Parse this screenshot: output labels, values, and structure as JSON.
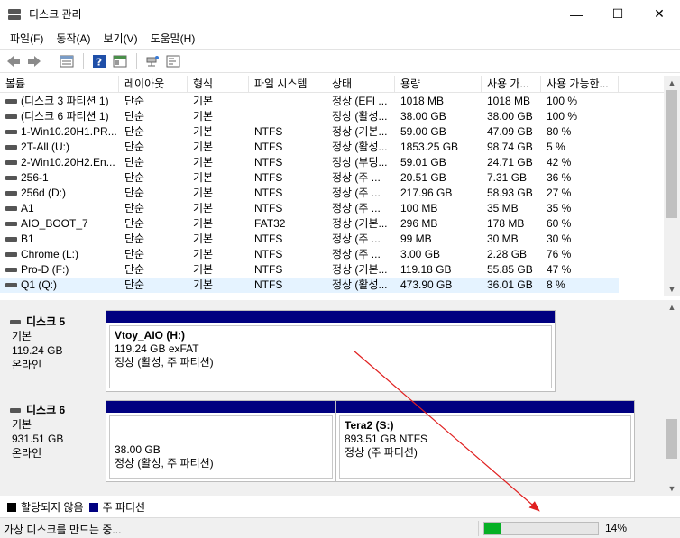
{
  "window": {
    "title": "디스크 관리",
    "min_glyph": "—",
    "max_glyph": "☐",
    "close_glyph": "✕"
  },
  "menu": [
    "파일(F)",
    "동작(A)",
    "보기(V)",
    "도움말(H)"
  ],
  "columns": [
    "볼륨",
    "레이아웃",
    "형식",
    "파일 시스템",
    "상태",
    "용량",
    "사용 가...",
    "사용 가능한..."
  ],
  "volumes": [
    [
      "(디스크 3 파티션 1)",
      "단순",
      "기본",
      "",
      "정상 (EFI ...",
      "1018 MB",
      "1018 MB",
      "100 %"
    ],
    [
      "(디스크 6 파티션 1)",
      "단순",
      "기본",
      "",
      "정상 (활성...",
      "38.00 GB",
      "38.00 GB",
      "100 %"
    ],
    [
      "1-Win10.20H1.PR...",
      "단순",
      "기본",
      "NTFS",
      "정상 (기본...",
      "59.00 GB",
      "47.09 GB",
      "80 %"
    ],
    [
      "2T-All (U:)",
      "단순",
      "기본",
      "NTFS",
      "정상 (활성...",
      "1853.25 GB",
      "98.74 GB",
      "5 %"
    ],
    [
      "2-Win10.20H2.En...",
      "단순",
      "기본",
      "NTFS",
      "정상 (부팅...",
      "59.01 GB",
      "24.71 GB",
      "42 %"
    ],
    [
      "256-1",
      "단순",
      "기본",
      "NTFS",
      "정상 (주 ...",
      "20.51 GB",
      "7.31 GB",
      "36 %"
    ],
    [
      "256d (D:)",
      "단순",
      "기본",
      "NTFS",
      "정상 (주 ...",
      "217.96 GB",
      "58.93 GB",
      "27 %"
    ],
    [
      "A1",
      "단순",
      "기본",
      "NTFS",
      "정상 (주 ...",
      "100 MB",
      "35 MB",
      "35 %"
    ],
    [
      "AIO_BOOT_7",
      "단순",
      "기본",
      "FAT32",
      "정상 (기본...",
      "296 MB",
      "178 MB",
      "60 %"
    ],
    [
      "B1",
      "단순",
      "기본",
      "NTFS",
      "정상 (주 ...",
      "99 MB",
      "30 MB",
      "30 %"
    ],
    [
      "Chrome (L:)",
      "단순",
      "기본",
      "NTFS",
      "정상 (주 ...",
      "3.00 GB",
      "2.28 GB",
      "76 %"
    ],
    [
      "Pro-D (F:)",
      "단순",
      "기본",
      "NTFS",
      "정상 (기본...",
      "119.18 GB",
      "55.85 GB",
      "47 %"
    ],
    [
      "Q1 (Q:)",
      "단순",
      "기본",
      "NTFS",
      "정상 (활성...",
      "473.90 GB",
      "36.01 GB",
      "8 %"
    ]
  ],
  "disks": [
    {
      "name": "디스크 5",
      "type": "기본",
      "size": "119.24 GB",
      "status": "온라인",
      "partitions": [
        {
          "name": "Vtoy_AIO  (H:)",
          "detail": "119.24 GB exFAT",
          "status": "정상 (활성, 주 파티션)"
        }
      ]
    },
    {
      "name": "디스크 6",
      "type": "기본",
      "size": "931.51 GB",
      "status": "온라인",
      "partitions": [
        {
          "name": "",
          "detail": "38.00 GB",
          "status": "정상 (활성, 주 파티션)"
        },
        {
          "name": "Tera2  (S:)",
          "detail": "893.51 GB NTFS",
          "status": "정상 (주 파티션)"
        }
      ]
    }
  ],
  "legend": [
    {
      "label": "할당되지 않음",
      "color": "#000000"
    },
    {
      "label": "주 파티션",
      "color": "#000080"
    }
  ],
  "status": {
    "text": "가상 디스크를 만드는 중...",
    "progress_label": "14%",
    "progress_value": 0.14
  },
  "colors": {
    "primary_partition": "#000080",
    "progress": "#06b025",
    "annotation_arrow": "#e02020"
  },
  "icons": [
    "disk-management-icon",
    "back-arrow-icon",
    "forward-arrow-icon",
    "disk-list-icon",
    "help-icon",
    "properties-icon",
    "rescan-icon",
    "settings-icon"
  ]
}
